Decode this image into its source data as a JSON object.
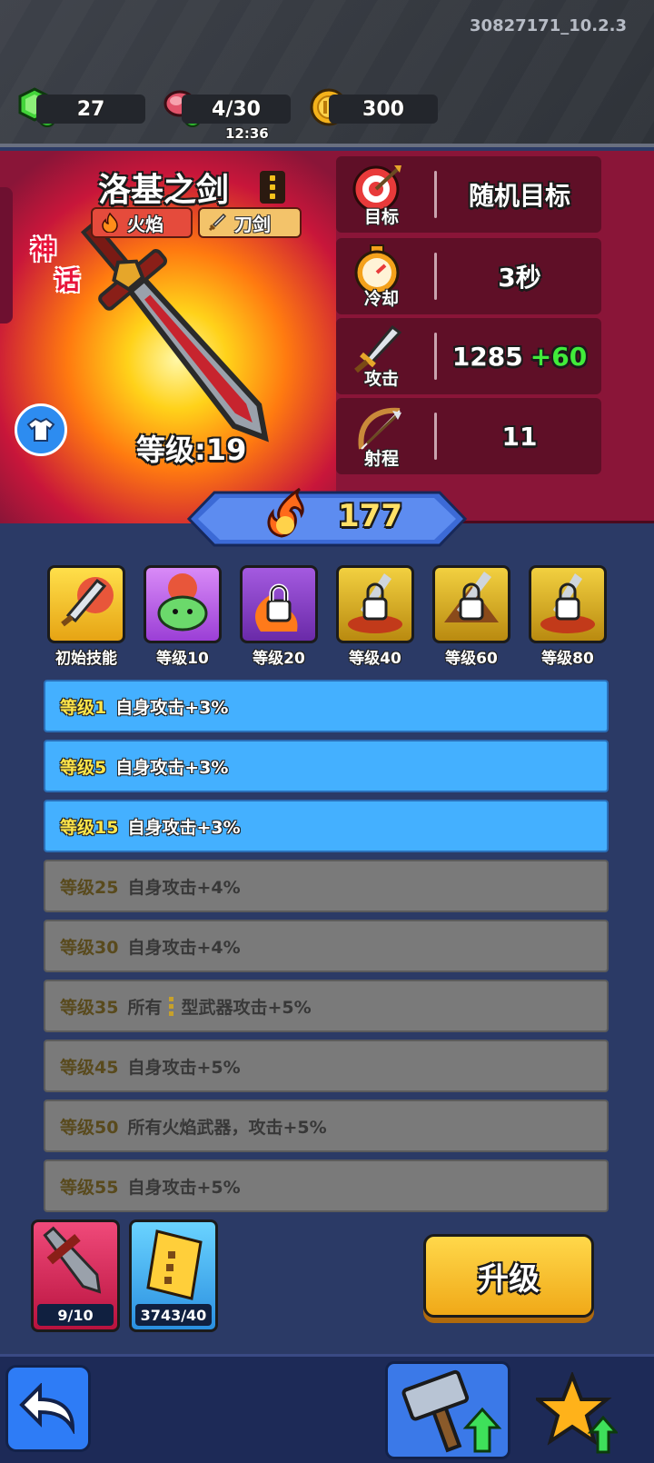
{
  "header": {
    "version": "30827171_10.2.3",
    "gems": "27",
    "energy": "4/30",
    "energy_timer": "12:36",
    "coins": "300"
  },
  "weapon": {
    "name": "洛基之剑",
    "tags": [
      {
        "label": "火焰",
        "icon": "flame-icon"
      },
      {
        "label": "刀剑",
        "icon": "sword-icon"
      }
    ],
    "rarity": [
      "神",
      "话"
    ],
    "level_label": "等级:19",
    "power": "177"
  },
  "stats": [
    {
      "key": "目标",
      "value": "随机目标",
      "bonus": "",
      "icon": "target-icon"
    },
    {
      "key": "冷却",
      "value": "3秒",
      "bonus": "",
      "icon": "stopwatch-icon"
    },
    {
      "key": "攻击",
      "value": "1285",
      "bonus": "+60",
      "icon": "sword-icon"
    },
    {
      "key": "射程",
      "value": "11",
      "bonus": "",
      "icon": "bow-icon"
    }
  ],
  "skills": [
    {
      "label": "初始技能",
      "locked": false,
      "icon": "sword-explosion-icon"
    },
    {
      "label": "等级10",
      "locked": false,
      "icon": "slime-icon"
    },
    {
      "label": "等级20",
      "locked": true,
      "icon": "fire-lock-icon"
    },
    {
      "label": "等级40",
      "locked": true,
      "icon": "blade-lock-icon"
    },
    {
      "label": "等级60",
      "locked": true,
      "icon": "dagger-lock-icon"
    },
    {
      "label": "等级80",
      "locked": true,
      "icon": "blade-fire-lock-icon"
    }
  ],
  "perks": [
    {
      "level": "等级1",
      "text": "自身攻击+3%",
      "active": true
    },
    {
      "level": "等级5",
      "text": "自身攻击+3%",
      "active": true
    },
    {
      "level": "等级15",
      "text": "自身攻击+3%",
      "active": true
    },
    {
      "level": "等级25",
      "text": "自身攻击+4%",
      "active": false
    },
    {
      "level": "等级30",
      "text": "自身攻击+4%",
      "active": false
    },
    {
      "level": "等级35",
      "text_pre": "所有",
      "text": "型武器攻击+5%",
      "active": false
    },
    {
      "level": "等级45",
      "text": "自身攻击+5%",
      "active": false
    },
    {
      "level": "等级50",
      "text": "所有火焰武器，攻击+5%",
      "active": false
    },
    {
      "level": "等级55",
      "text": "自身攻击+5%",
      "active": false
    }
  ],
  "materials": [
    {
      "count": "9/10",
      "icon": "sword-shard-icon"
    },
    {
      "count": "3743/40",
      "icon": "scroll-icon"
    }
  ],
  "upgrade_label": "升级"
}
